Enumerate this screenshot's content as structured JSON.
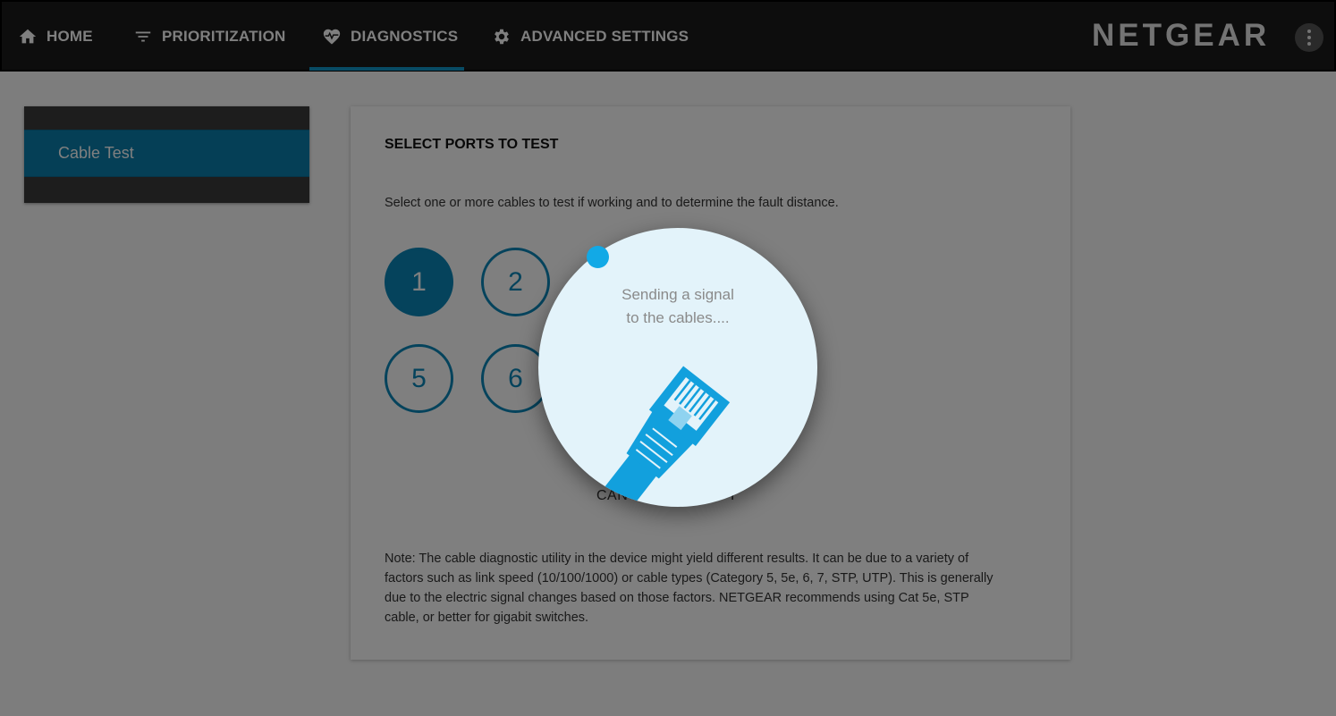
{
  "nav": {
    "home": "HOME",
    "prioritization": "PRIORITIZATION",
    "diagnostics": "DIAGNOSTICS",
    "advanced": "ADVANCED SETTINGS",
    "brand": "NETGEAR",
    "icons": [
      "home-icon",
      "filter-icon",
      "heart-pulse-icon",
      "gear-icon",
      "more-vert-icon"
    ]
  },
  "sidebar": {
    "items": [
      {
        "label": "Cable Test",
        "active": true
      }
    ]
  },
  "card": {
    "title": "SELECT PORTS TO TEST",
    "description": "Select one or more cables to test if working and to determine the fault distance.",
    "ports": [
      {
        "label": "1",
        "selected": true
      },
      {
        "label": "2",
        "selected": false
      },
      {
        "label": "5",
        "selected": false
      },
      {
        "label": "6",
        "selected": false
      }
    ],
    "cancel_partial": "CAN",
    "cancel_partial_end": "T",
    "note": "Note: The cable diagnostic utility in the device might yield different results. It can be due to a variety of factors such as link speed (10/100/1000) or cable types (Category 5, 5e, 6, 7, STP, UTP). This is generally due to the electric signal changes based on those factors. NETGEAR recommends using Cat 5e, STP cable, or better for gigabit switches."
  },
  "popup": {
    "line1": "Sending a signal",
    "line2": "to the cables....",
    "icon": "ethernet-cable-icon"
  },
  "colors": {
    "accent": "#0a86b9",
    "nav_bg": "#1a1a1a",
    "popup_bg": "#e3f3fa",
    "dot": "#12a9e6"
  }
}
